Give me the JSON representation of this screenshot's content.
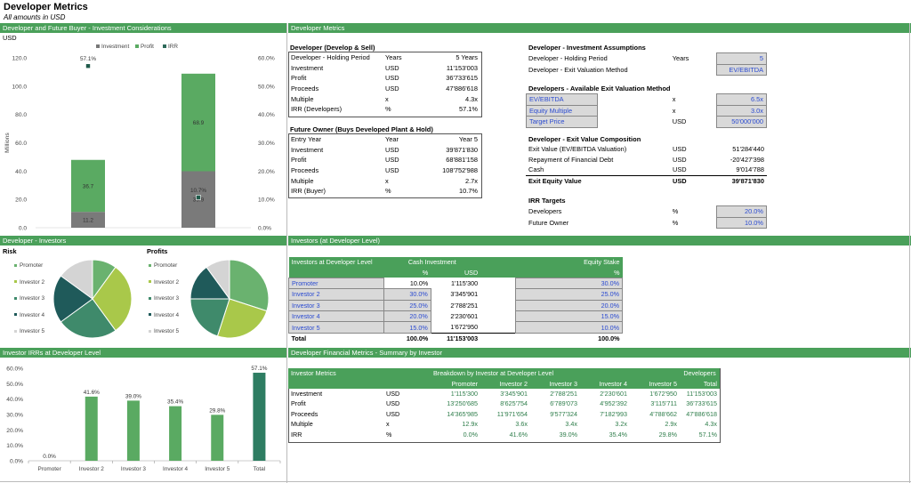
{
  "page": {
    "title": "Developer Metrics",
    "subtitle": "All amounts in USD"
  },
  "headers": {
    "dev_future": "Developer and Future Buyer - Investment Considerations",
    "dev_metrics": "Developer Metrics",
    "dev_investors": "Developer - Investors",
    "investors_dev_level": "Investors (at Developer Level)",
    "investor_irrs": "Investor IRRs at Developer Level",
    "fin_summary": "Developer Financial Metrics - Summary by Investor"
  },
  "colors": {
    "green": "#4aa05a",
    "dark_green": "#2e7d4a",
    "gray": "#777777",
    "input_blue": "#2b4bd1"
  },
  "chart_data": [
    {
      "type": "bar",
      "stacked": true,
      "unit_label": "USD",
      "ylabel": "Millions",
      "ylim": [
        0,
        120
      ],
      "y2lim": [
        0,
        0.6
      ],
      "yticks": [
        "0.0",
        "20.0",
        "40.0",
        "60.0",
        "80.0",
        "100.0",
        "120.0"
      ],
      "y2ticks": [
        "0.0%",
        "10.0%",
        "20.0%",
        "30.0%",
        "40.0%",
        "50.0%",
        "60.0%"
      ],
      "legend": [
        "Investment",
        "Profit",
        "IRR"
      ],
      "legend_position": "top",
      "series": [
        {
          "name": "Investment",
          "values": [
            11.2,
            39.9
          ],
          "labels": [
            "11.2",
            "39.9"
          ]
        },
        {
          "name": "Profit",
          "values": [
            36.7,
            68.9
          ],
          "labels": [
            "36.7",
            "68.9"
          ]
        },
        {
          "name": "IRR",
          "values": [
            0.571,
            0.107
          ],
          "labels": [
            "57.1%",
            "10.7%"
          ]
        }
      ]
    },
    {
      "type": "pie",
      "title": "Risk",
      "legend": [
        "Promoter",
        "Investor 2",
        "Investor 3",
        "Investor 4",
        "Investor 5"
      ],
      "legend_position": "left",
      "values": [
        10.0,
        30.0,
        25.0,
        20.0,
        15.0
      ],
      "colors": [
        "#6ab26f",
        "#a9c84a",
        "#3f8a6b",
        "#1f5a5a",
        "#d4d4d4"
      ]
    },
    {
      "type": "pie",
      "title": "Profits",
      "legend": [
        "Promoter",
        "Investor 2",
        "Investor 3",
        "Investor 4",
        "Investor 5"
      ],
      "legend_position": "left",
      "values": [
        30.0,
        25.0,
        20.0,
        15.0,
        10.0
      ],
      "colors": [
        "#6ab26f",
        "#a9c84a",
        "#3f8a6b",
        "#1f5a5a",
        "#d4d4d4"
      ]
    },
    {
      "type": "bar",
      "ylim": [
        0,
        0.6
      ],
      "yticks": [
        "0.0%",
        "10.0%",
        "20.0%",
        "30.0%",
        "40.0%",
        "50.0%",
        "60.0%"
      ],
      "categories": [
        "Promoter",
        "Investor 2",
        "Investor 3",
        "Investor 4",
        "Investor 5",
        "Total"
      ],
      "values": [
        0.0,
        0.416,
        0.39,
        0.354,
        0.298,
        0.571
      ],
      "labels": [
        "0.0%",
        "41.6%",
        "39.0%",
        "35.4%",
        "29.8%",
        "57.1%"
      ],
      "colors": [
        "#5aaa62",
        "#5aaa62",
        "#5aaa62",
        "#5aaa62",
        "#5aaa62",
        "#2e7d62"
      ]
    }
  ],
  "developer": {
    "title": "Developer (Develop & Sell)",
    "rows": [
      {
        "label": "Developer - Holding Period",
        "unit": "Years",
        "value": "5 Years"
      },
      {
        "label": "Investment",
        "unit": "USD",
        "value": "11'153'003"
      },
      {
        "label": "Profit",
        "unit": "USD",
        "value": "36'733'615"
      },
      {
        "label": "Proceeds",
        "unit": "USD",
        "value": "47'886'618"
      },
      {
        "label": "Multiple",
        "unit": "x",
        "value": "4.3x"
      },
      {
        "label": "IRR (Developers)",
        "unit": "%",
        "value": "57.1%"
      }
    ]
  },
  "future_owner": {
    "title": "Future Owner (Buys Developed Plant & Hold)",
    "rows": [
      {
        "label": "Entry Year",
        "unit": "Year",
        "value": "Year 5"
      },
      {
        "label": "Investment",
        "unit": "USD",
        "value": "39'871'830"
      },
      {
        "label": "Profit",
        "unit": "USD",
        "value": "68'881'158"
      },
      {
        "label": "Proceeds",
        "unit": "USD",
        "value": "108'752'988"
      },
      {
        "label": "Multiple",
        "unit": "x",
        "value": "2.7x"
      },
      {
        "label": "IRR (Buyer)",
        "unit": "%",
        "value": "10.7%"
      }
    ]
  },
  "inv_assumptions": {
    "title": "Developer - Investment Assumptions",
    "rows": [
      {
        "label": "Developer - Holding Period",
        "unit": "Years",
        "value": "5"
      },
      {
        "label": "Developer - Exit Valuation Method",
        "unit": "",
        "value": "EV/EBITDA"
      }
    ]
  },
  "exit_methods": {
    "title": "Developers - Available Exit Valuation Method",
    "rows": [
      {
        "label": "EV/EBITDA",
        "unit": "x",
        "value": "6.5x"
      },
      {
        "label": "Equity Multiple",
        "unit": "x",
        "value": "3.0x"
      },
      {
        "label": "Target Price",
        "unit": "USD",
        "value": "50'000'000"
      }
    ]
  },
  "exit_composition": {
    "title": "Developer - Exit Value Composition",
    "rows": [
      {
        "label": "Exit Value (EV/EBITDA Valuation)",
        "unit": "USD",
        "value": "51'284'440"
      },
      {
        "label": "Repayment of Financial Debt",
        "unit": "USD",
        "value": "-20'427'398"
      },
      {
        "label": "Cash",
        "unit": "USD",
        "value": "9'014'788"
      },
      {
        "label": "Exit Equity Value",
        "unit": "USD",
        "value": "39'871'830"
      }
    ]
  },
  "irr_targets": {
    "title": "IRR Targets",
    "rows": [
      {
        "label": "Developers",
        "unit": "%",
        "value": "20.0%"
      },
      {
        "label": "Future Owner",
        "unit": "%",
        "value": "10.0%"
      }
    ]
  },
  "investors_table": {
    "h1": [
      "Investors at Developer Level",
      "Cash Investment",
      "Equity Stake"
    ],
    "h2": [
      "%",
      "USD",
      "%"
    ],
    "rows": [
      {
        "name": "Promoter",
        "pct": "10.0%",
        "usd": "1'115'300",
        "stake": "30.0%"
      },
      {
        "name": "Investor 2",
        "pct": "30.0%",
        "usd": "3'345'901",
        "stake": "25.0%"
      },
      {
        "name": "Investor 3",
        "pct": "25.0%",
        "usd": "2'788'251",
        "stake": "20.0%"
      },
      {
        "name": "Investor 4",
        "pct": "20.0%",
        "usd": "2'230'601",
        "stake": "15.0%"
      },
      {
        "name": "Investor 5",
        "pct": "15.0%",
        "usd": "1'672'950",
        "stake": "10.0%"
      }
    ],
    "total": {
      "name": "Total",
      "pct": "100.0%",
      "usd": "11'153'003",
      "stake": "100.0%"
    }
  },
  "fin_table": {
    "h1": [
      "Investor Metrics",
      "Breakdown by Investor at Developer Level",
      "Developers"
    ],
    "cols": [
      "Promoter",
      "Investor 2",
      "Investor 3",
      "Investor 4",
      "Investor 5",
      "Total"
    ],
    "rows": [
      {
        "label": "Investment",
        "unit": "USD",
        "vals": [
          "1'115'300",
          "3'345'901",
          "2'788'251",
          "2'230'601",
          "1'672'950",
          "11'153'003"
        ]
      },
      {
        "label": "Profit",
        "unit": "USD",
        "vals": [
          "13'250'685",
          "8'625'754",
          "6'789'073",
          "4'952'392",
          "3'115'711",
          "36'733'615"
        ]
      },
      {
        "label": "Proceeds",
        "unit": "USD",
        "vals": [
          "14'365'985",
          "11'971'654",
          "9'577'324",
          "7'182'993",
          "4'788'662",
          "47'886'618"
        ]
      },
      {
        "label": "Multiple",
        "unit": "x",
        "vals": [
          "12.9x",
          "3.6x",
          "3.4x",
          "3.2x",
          "2.9x",
          "4.3x"
        ]
      },
      {
        "label": "IRR",
        "unit": "%",
        "vals": [
          "0.0%",
          "41.6%",
          "39.0%",
          "35.4%",
          "29.8%",
          "57.1%"
        ]
      }
    ]
  }
}
